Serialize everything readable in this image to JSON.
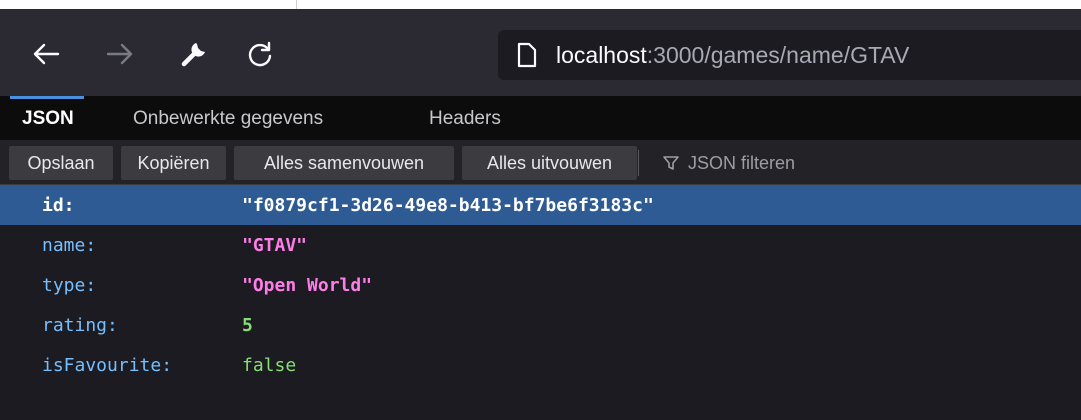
{
  "browser": {
    "url_host": "localhost",
    "url_rest": ":3000/games/name/GTAV"
  },
  "tabs": [
    {
      "label": "JSON",
      "active": true
    },
    {
      "label": "Onbewerkte gegevens",
      "active": false
    },
    {
      "label": "Headers",
      "active": false
    }
  ],
  "toolbar": {
    "save_label": "Opslaan",
    "copy_label": "Kopiëren",
    "collapse_label": "Alles samenvouwen",
    "expand_label": "Alles uitvouwen",
    "filter_placeholder": "JSON filteren"
  },
  "json_rows": [
    {
      "key": "id:",
      "value": "\"f0879cf1-3d26-49e8-b413-bf7be6f3183c\"",
      "value_type": "string",
      "selected": true
    },
    {
      "key": "name:",
      "value": "\"GTAV\"",
      "value_type": "string",
      "selected": false
    },
    {
      "key": "type:",
      "value": "\"Open World\"",
      "value_type": "string",
      "selected": false
    },
    {
      "key": "rating:",
      "value": "5",
      "value_type": "number",
      "selected": false
    },
    {
      "key": "isFavourite:",
      "value": "false",
      "value_type": "boolean",
      "selected": false
    }
  ],
  "colors": {
    "selection": "#2f5b94",
    "key": "#75bfff",
    "string": "#ff7de9",
    "number": "#86de74",
    "tab_indicator": "#4a90e2"
  },
  "icons": [
    "back-arrow-icon",
    "forward-arrow-icon",
    "wrench-icon",
    "reload-icon",
    "page-icon",
    "filter-icon"
  ]
}
